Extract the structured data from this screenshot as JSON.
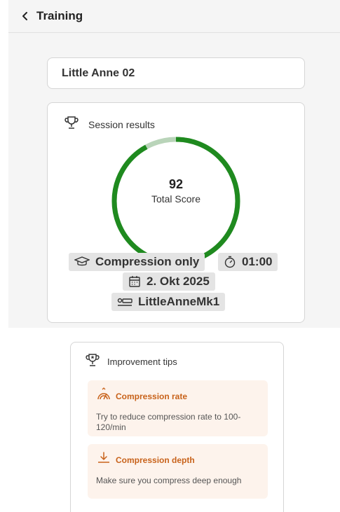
{
  "header": {
    "title": "Training"
  },
  "device": {
    "name": "Little Anne 02"
  },
  "results": {
    "title": "Session results",
    "score": "92",
    "score_label": "Total Score",
    "score_fraction": 0.92,
    "ring_color": "#1f8a1f",
    "ring_remainder_color": "#b9d4b9",
    "mode": "Compression only",
    "duration": "01:00",
    "date": "2. Okt 2025",
    "manikin": "LittleAnneMk1"
  },
  "tips": {
    "title": "Improvement tips",
    "accent_color": "#c8621a",
    "items": [
      {
        "title": "Compression rate",
        "text": "Try to reduce compression rate to 100-120/min",
        "icon": "gauge-icon"
      },
      {
        "title": "Compression depth",
        "text": "Make sure you compress deep enough",
        "icon": "arrow-down-icon"
      }
    ]
  }
}
